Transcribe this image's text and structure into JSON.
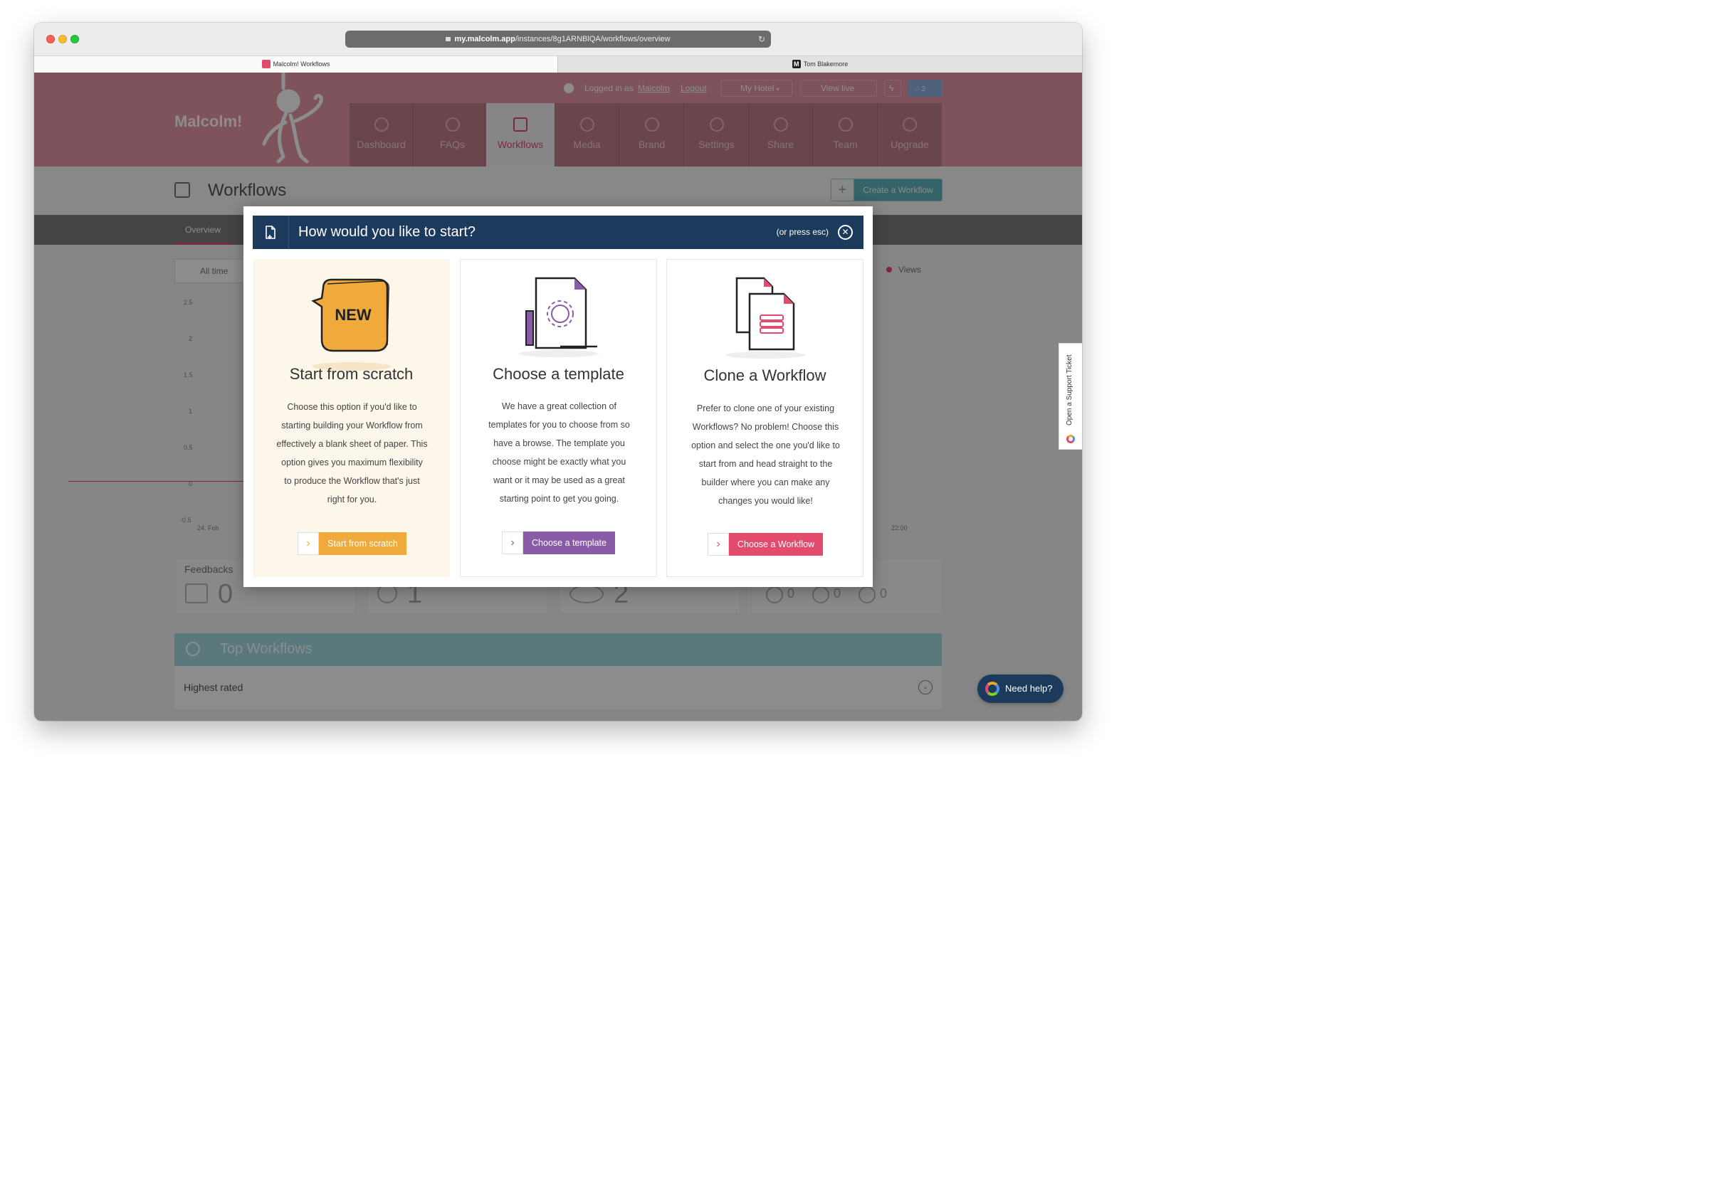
{
  "browser": {
    "url_domain": "my.malcolm.app",
    "url_path": "/instances/8g1ARNBlQA/workflows/overview",
    "tabs": [
      {
        "label": "Malcolm! Workflows"
      },
      {
        "label": "Tom Blakemore"
      }
    ]
  },
  "header": {
    "logo": "Malcolm!",
    "logged_in_prefix": "Logged in as",
    "user": "Malcolm",
    "logout": "Logout",
    "hotel": "My Hotel",
    "view_live": "View live",
    "notif_count": "2"
  },
  "nav": {
    "items": [
      {
        "label": "Dashboard"
      },
      {
        "label": "FAQs"
      },
      {
        "label": "Workflows"
      },
      {
        "label": "Media"
      },
      {
        "label": "Brand"
      },
      {
        "label": "Settings"
      },
      {
        "label": "Share"
      },
      {
        "label": "Team"
      },
      {
        "label": "Upgrade"
      }
    ],
    "active_index": 2
  },
  "subheader": {
    "title": "Workflows",
    "create_button": "Create a Workflow",
    "overview_tab": "Overview",
    "filter": "All time",
    "legend": "Views"
  },
  "chart": {
    "y_ticks": [
      "2.5",
      "2",
      "1.5",
      "1",
      "0.5",
      "0",
      "-0.5"
    ],
    "x_start": "24. Feb",
    "x_end": "22:00"
  },
  "stats": {
    "feedbacks_label": "Feedbacks",
    "feedbacks_value": "0",
    "searches_value": "1",
    "views_value": "2",
    "happy": "0",
    "neutral": "0",
    "sad": "0"
  },
  "top_workflows": {
    "title": "Top Workflows",
    "highest_rated": "Highest rated"
  },
  "modal": {
    "title": "How would you like to start?",
    "esc_hint": "(or press esc)",
    "options": [
      {
        "badge": "NEW",
        "title": "Start from scratch",
        "lines": [
          "Choose this option if you'd like to",
          "starting building your Workflow from",
          "effectively a blank sheet of paper. This",
          "option gives you maximum flexibility",
          "to produce the Workflow that's just",
          "right for you."
        ],
        "button": "Start from scratch",
        "color": "#f0a93b"
      },
      {
        "title": "Choose a template",
        "lines": [
          "We have a great collection of",
          "templates for you to choose from so",
          "have a browse. The template you",
          "choose might be exactly what you",
          "want or it may be used as a great",
          "starting point to get you going."
        ],
        "button": "Choose a template",
        "color": "#8a5ca8"
      },
      {
        "title": "Clone a Workflow",
        "lines": [
          "Prefer to clone one of your existing",
          "Workflows? No problem! Choose this",
          "option and select the one you'd like to",
          "start from and head straight to the",
          "builder where you can make any",
          "changes you would like!"
        ],
        "button": "Choose a Workflow",
        "color": "#e24b6e"
      }
    ]
  },
  "support": {
    "side_tab": "Open a Support Ticket",
    "need_help": "Need help?"
  },
  "colors": {
    "header_pink": "#e897a7",
    "modal_navy": "#1b3a5c",
    "accent_pink": "#e24b6e",
    "orange": "#f0a93b",
    "purple": "#8a5ca8",
    "teal": "#5fb4bd"
  }
}
